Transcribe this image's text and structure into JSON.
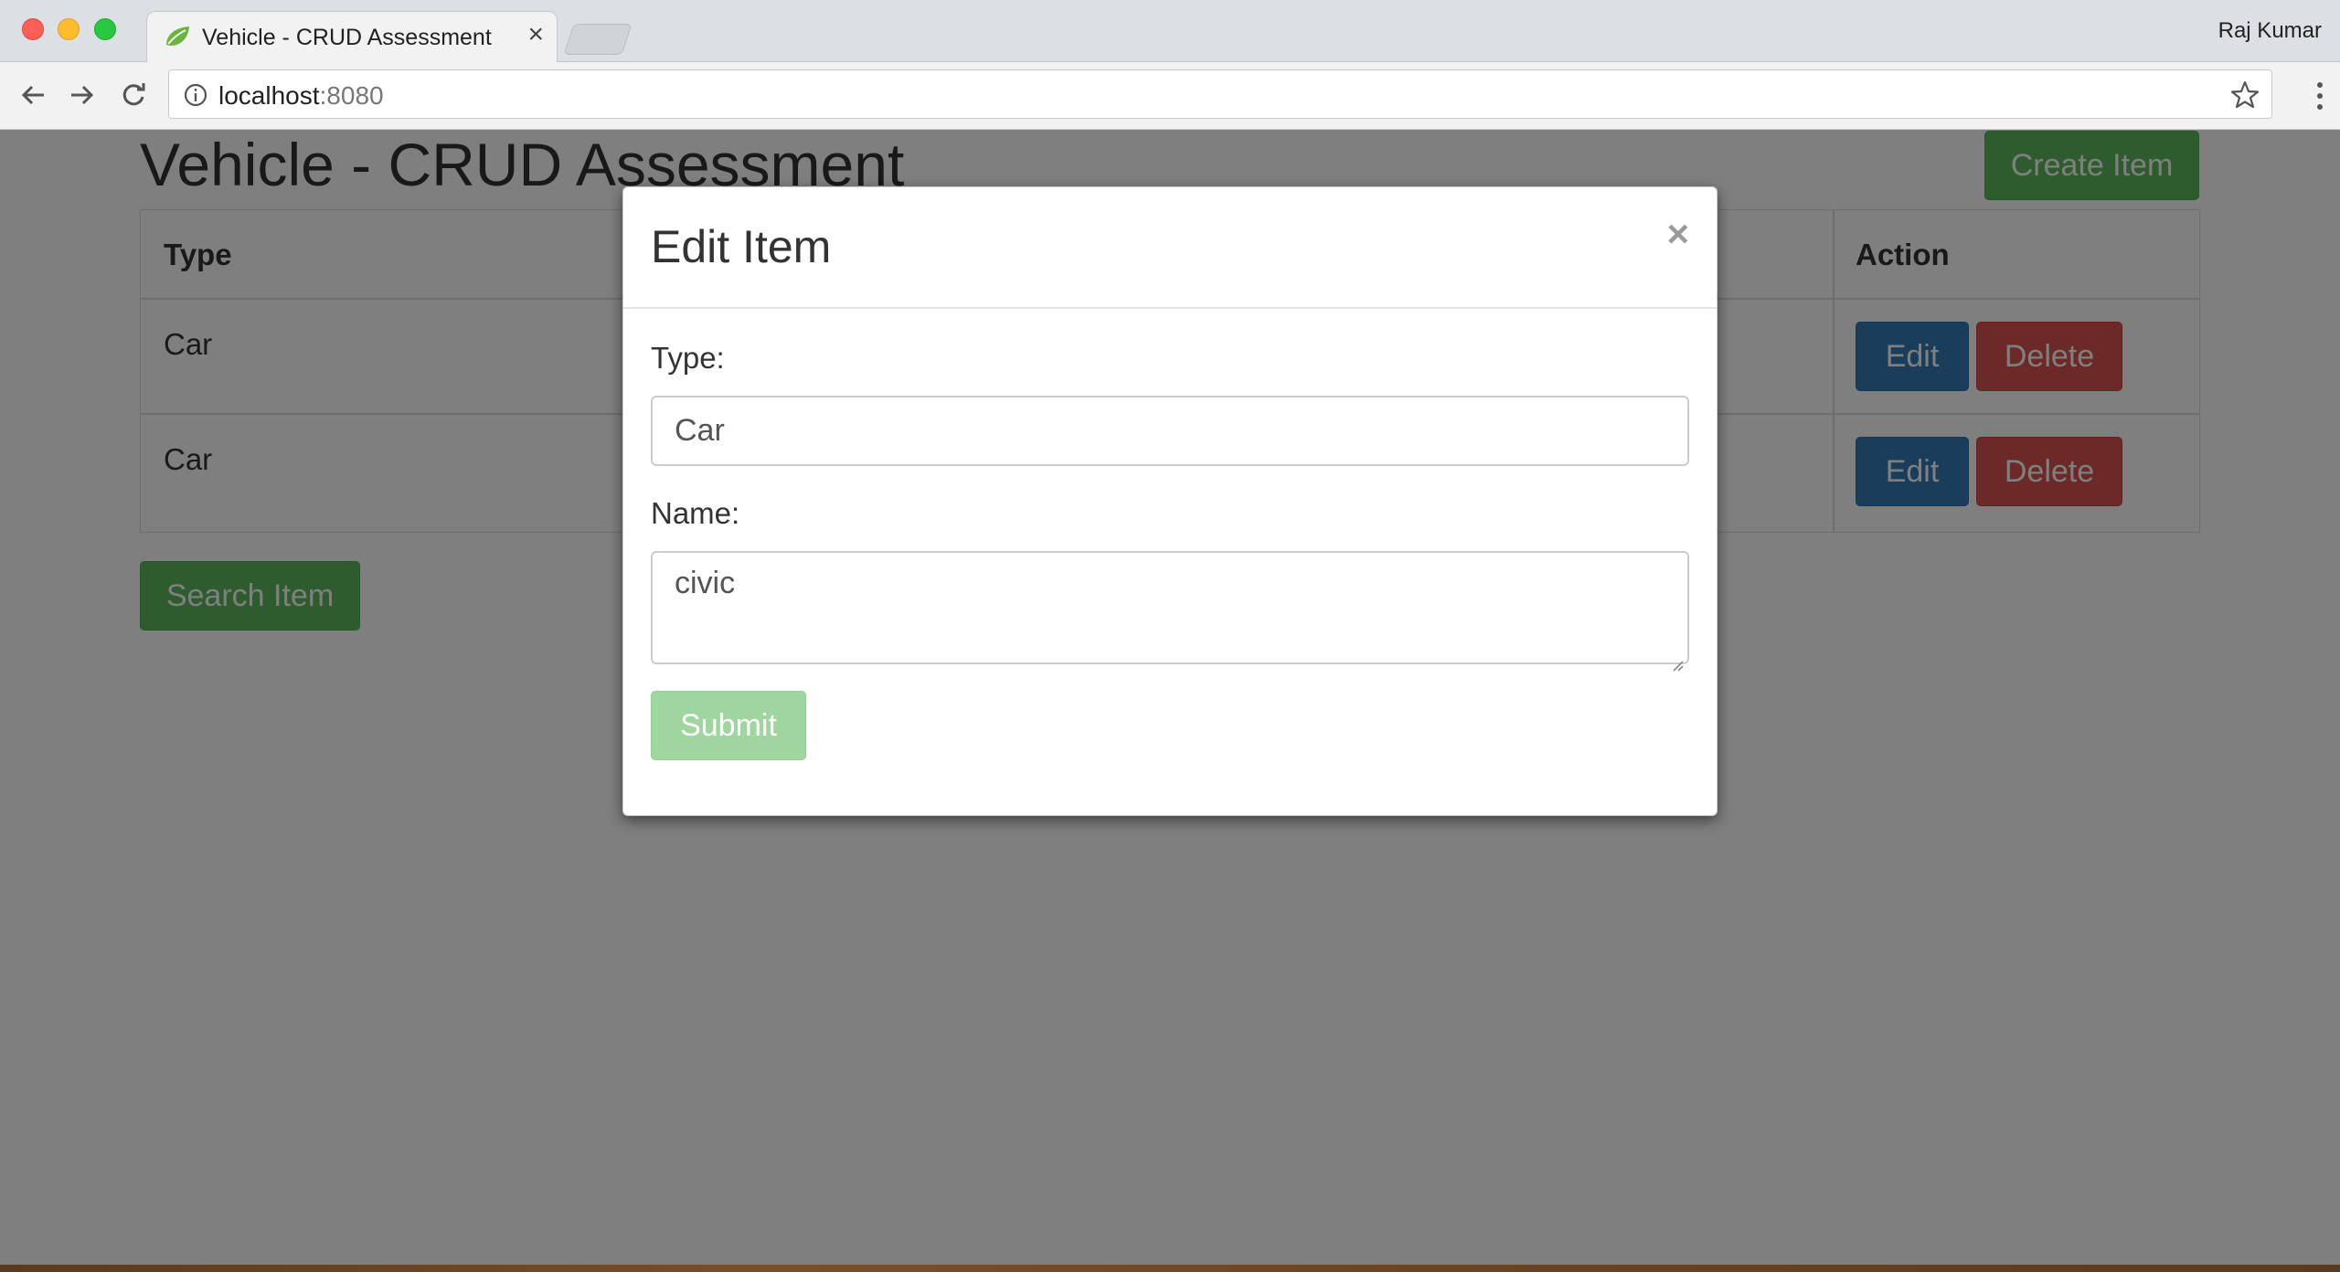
{
  "browser": {
    "tab_title": "Vehicle - CRUD Assessment",
    "tab_close": "×",
    "profile_name": "Raj Kumar",
    "url_host": "localhost",
    "url_port": ":8080"
  },
  "page": {
    "title": "Vehicle - CRUD Assessment",
    "create_label": "Create Item",
    "search_label": "Search Item",
    "table": {
      "headers": {
        "type": "Type",
        "action": "Action"
      },
      "rows": [
        {
          "type": "Car",
          "edit_label": "Edit",
          "delete_label": "Delete"
        },
        {
          "type": "Car",
          "edit_label": "Edit",
          "delete_label": "Delete"
        }
      ]
    }
  },
  "modal": {
    "title": "Edit Item",
    "close_symbol": "×",
    "type_label": "Type:",
    "type_value": "Car",
    "name_label": "Name:",
    "name_value": "civic",
    "submit_label": "Submit"
  },
  "colors": {
    "success": "#5cb85c",
    "primary": "#337ab7",
    "danger": "#d9534f",
    "submit_disabled": "#9fd69f"
  }
}
